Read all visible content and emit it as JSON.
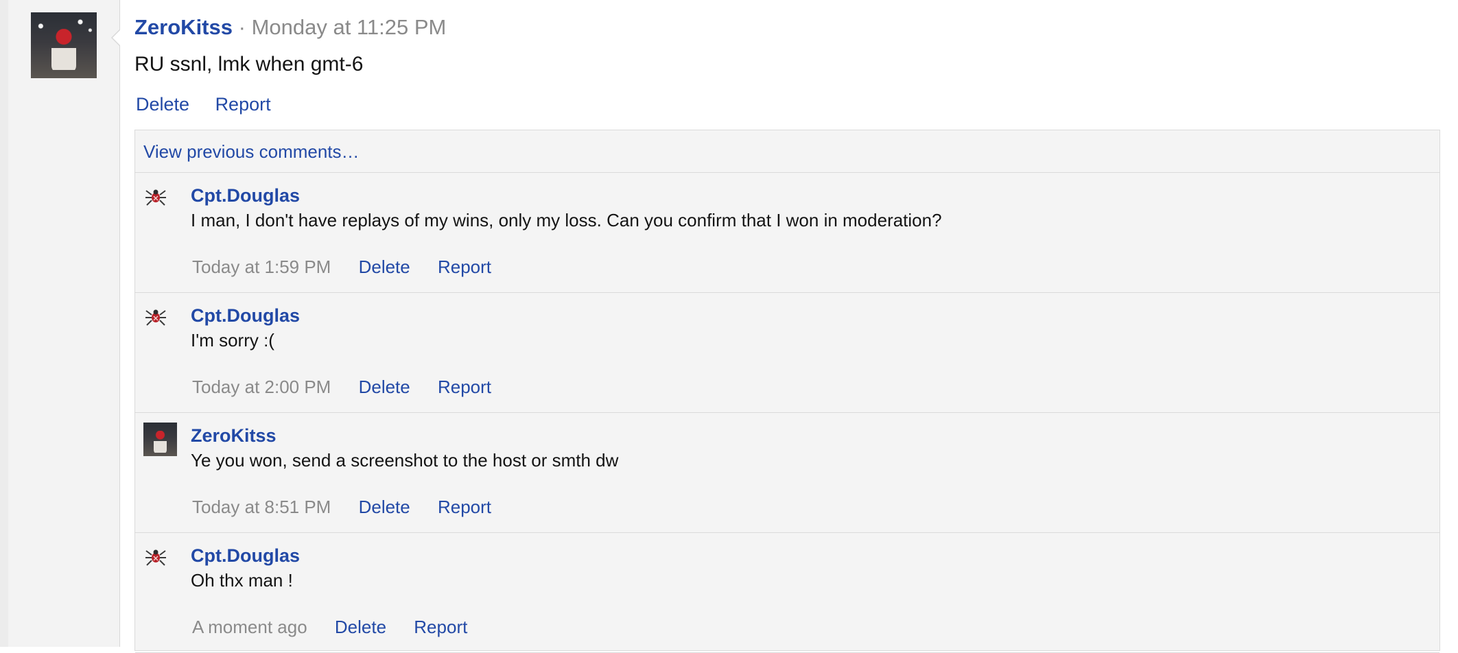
{
  "post": {
    "author": "ZeroKitss",
    "separator": "·",
    "time": "Monday at 11:25 PM",
    "body": "RU ssnl, lmk when gmt-6",
    "delete_label": "Delete",
    "report_label": "Report"
  },
  "comments_section": {
    "view_previous": "View previous comments…",
    "items": [
      {
        "author": "Cpt.Douglas",
        "avatar": "spider-emblem-icon",
        "text": "I man, I don't have replays of my wins, only my loss. Can you confirm that I won in moderation?",
        "time": "Today at 1:59 PM",
        "delete_label": "Delete",
        "report_label": "Report"
      },
      {
        "author": "Cpt.Douglas",
        "avatar": "spider-emblem-icon",
        "text": "I'm sorry :(",
        "time": "Today at 2:00 PM",
        "delete_label": "Delete",
        "report_label": "Report"
      },
      {
        "author": "ZeroKitss",
        "avatar": "photo-avatar",
        "text": "Ye you won, send a screenshot to the host or smth dw",
        "time": "Today at 8:51 PM",
        "delete_label": "Delete",
        "report_label": "Report"
      },
      {
        "author": "Cpt.Douglas",
        "avatar": "spider-emblem-icon",
        "text": "Oh thx man !",
        "time": "A moment ago",
        "delete_label": "Delete",
        "report_label": "Report"
      }
    ]
  },
  "colors": {
    "link": "#2249a6",
    "muted": "#8a8a8a",
    "comment_bg": "#f4f4f4",
    "text": "#141414"
  }
}
